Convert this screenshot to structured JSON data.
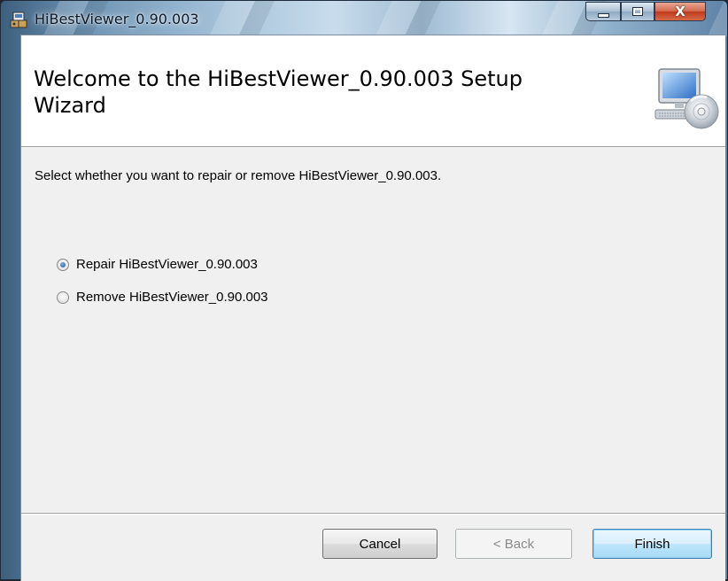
{
  "window": {
    "title": "HiBestViewer_0.90.003",
    "icon": "installer-package-icon",
    "controls": {
      "minimize": "minimize-icon",
      "maximize": "maximize-icon",
      "close_label": "X"
    }
  },
  "banner": {
    "title": "Welcome to the HiBestViewer_0.90.003 Setup Wizard",
    "icon": "computer-cd-icon"
  },
  "body": {
    "instruction": "Select whether you want to repair or remove HiBestViewer_0.90.003.",
    "options": [
      {
        "label": "Repair HiBestViewer_0.90.003",
        "selected": true
      },
      {
        "label": "Remove HiBestViewer_0.90.003",
        "selected": false
      }
    ]
  },
  "buttons": {
    "cancel": "Cancel",
    "back": "< Back",
    "finish": "Finish"
  },
  "colors": {
    "accent": "#3c7fb1",
    "client_bg": "#f0f0f0",
    "banner_bg": "#ffffff"
  }
}
